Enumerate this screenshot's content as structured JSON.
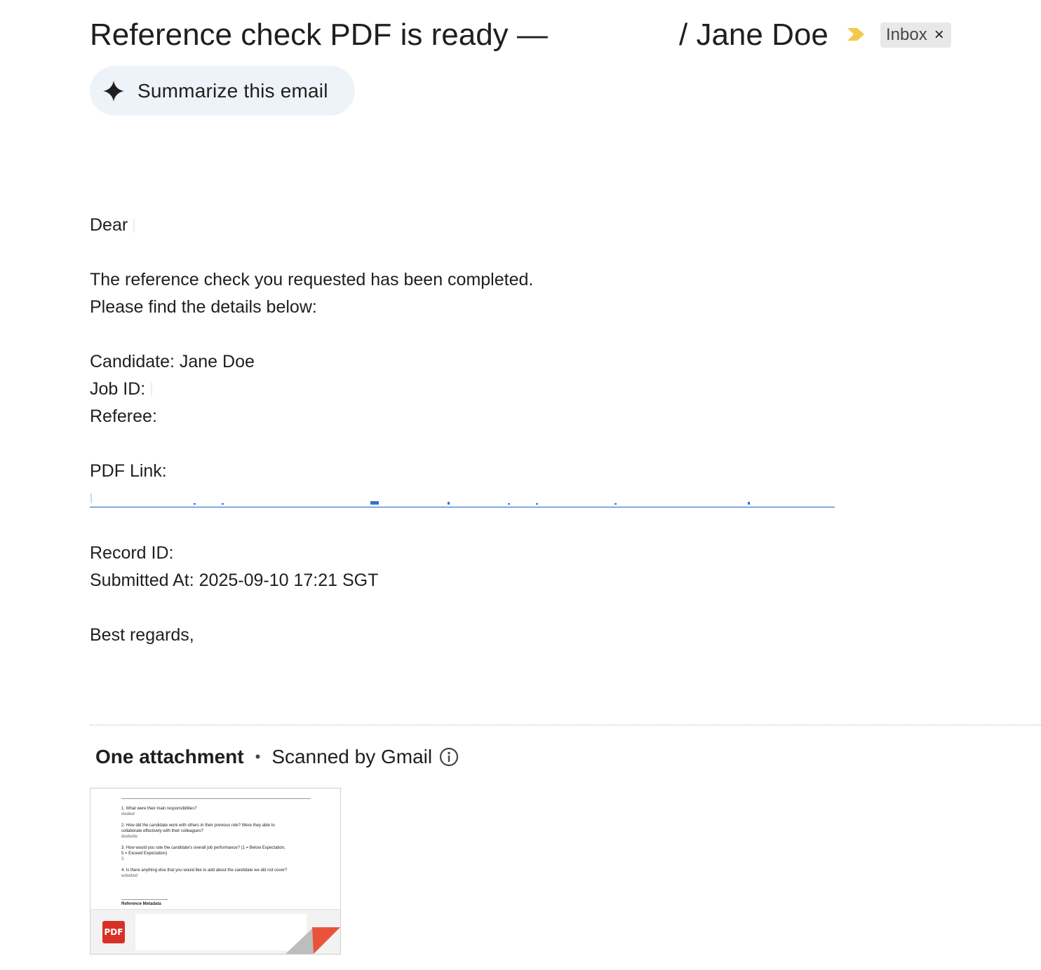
{
  "header": {
    "subject_left": "Reference check PDF is ready —",
    "subject_right": "/ Jane Doe",
    "label": "Inbox",
    "label_remove_glyph": "×",
    "importance_icon": "importance-marker-icon",
    "importance_color": "#f2c94c"
  },
  "summarize": {
    "label": "Summarize this email",
    "icon": "sparkle-icon"
  },
  "email_body": {
    "greeting": "Dear",
    "intro_line1": "The reference check you requested has been completed.",
    "intro_line2": "Please find the details below:",
    "candidate": "Candidate: Jane Doe",
    "job_id": "Job ID:",
    "referee": "Referee:",
    "pdf_link_label": "PDF Link:",
    "record_id": "Record ID:",
    "submitted_at": "Submitted At: 2025-09-10 17:21 SGT",
    "signoff": "Best regards,"
  },
  "attachments": {
    "count_label": "One attachment",
    "separator": "•",
    "scanned_label": "Scanned by Gmail",
    "info_icon": "info-icon",
    "file_type": "PDF",
    "file_type_color": "#d93025",
    "preview": {
      "q1": "1. What were their main responsibilities?",
      "a1": "dwdwd",
      "q2a": "2. How did the candidate work with others in their previous role? Were they able to",
      "q2b": "collaborate effectively with their colleagues?",
      "a2": "dwdwdw",
      "q3a": "3. How would you rate the candidate's overall job performance? (1 = Below Expectation,",
      "q3b": "5 = Exceed Expectation)",
      "a3": "3",
      "q4": "4. Is there anything else that you would like to add about the candidate we did not cover?",
      "a4": "wdwdwd",
      "meta_heading": "Reference Metadata"
    }
  }
}
